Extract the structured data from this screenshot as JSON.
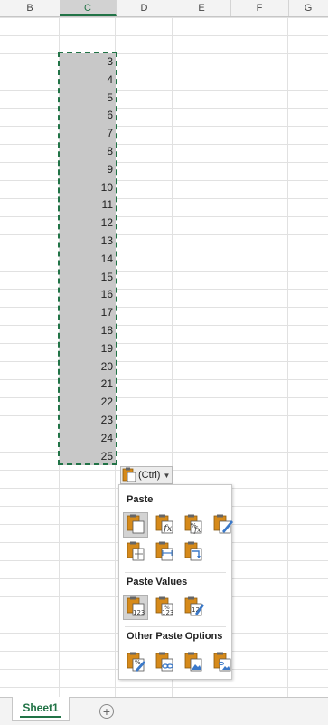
{
  "columns": [
    "B",
    "C",
    "D",
    "E",
    "F",
    "G"
  ],
  "selected_column": "C",
  "cell_values": [
    "3",
    "4",
    "5",
    "6",
    "7",
    "8",
    "9",
    "10",
    "11",
    "12",
    "13",
    "14",
    "15",
    "16",
    "17",
    "18",
    "19",
    "20",
    "21",
    "22",
    "23",
    "24",
    "25"
  ],
  "ctrl_button": {
    "label": "(Ctrl)",
    "icon": "clipboard-icon",
    "dropdown_icon": "dropdown-arrow-icon"
  },
  "paste_menu": {
    "paste_heading": "Paste",
    "paste_options": [
      "paste-icon",
      "formulas-icon",
      "formulas-number-formatting-icon",
      "keep-source-formatting-icon",
      "no-borders-icon",
      "keep-column-widths-icon",
      "transpose-icon"
    ],
    "values_heading": "Paste Values",
    "values_options": [
      "values-icon",
      "values-number-formatting-icon",
      "values-source-formatting-icon"
    ],
    "other_heading": "Other Paste Options",
    "other_options": [
      "formatting-icon",
      "paste-link-icon",
      "picture-icon",
      "linked-picture-icon"
    ]
  },
  "sheet_tab": "Sheet1",
  "add_sheet_icon": "plus-circle-icon",
  "accent_color": "#217346",
  "clipboard_color": "#d68a1a"
}
